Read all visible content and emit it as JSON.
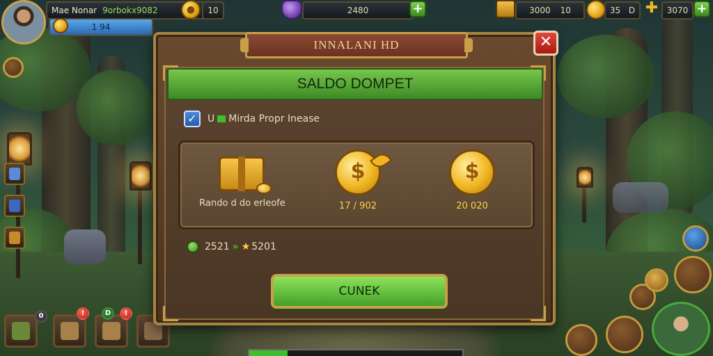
{
  "hud": {
    "player_name": "Mae Nonar",
    "player_tag": "9orbokx9082",
    "level_value": "1 94",
    "coins_value": "10",
    "gems_value": "2480",
    "stat1_value": "3000",
    "stat1_small": "10",
    "stat2_value": "35",
    "stat2_letter": "D",
    "stat3_value": "3070"
  },
  "modal": {
    "title": "INNALANI HD",
    "close_label": "✕",
    "header": "SALDO DOMPET",
    "checkbox_prefix": "U",
    "checkbox_text": "Mirda Propr Inease",
    "rewards": [
      {
        "label": "Rando d do erleofe",
        "value": ""
      },
      {
        "label": "",
        "value": "17 / 902"
      },
      {
        "label": "",
        "value": "20 020"
      }
    ],
    "stat_value": "2521",
    "stat_value2": "5201",
    "confirm_label": "CUNEK"
  },
  "bottom_slots": {
    "badge1": "0",
    "badge2": "!",
    "badge3": "D",
    "badge4": "!"
  },
  "colors": {
    "accent_green": "#3fbf2c",
    "gold": "#ffd24a",
    "wood": "#4b3320",
    "close_red": "#d2352a"
  },
  "progress": {
    "bottom_bar": 0.18
  }
}
